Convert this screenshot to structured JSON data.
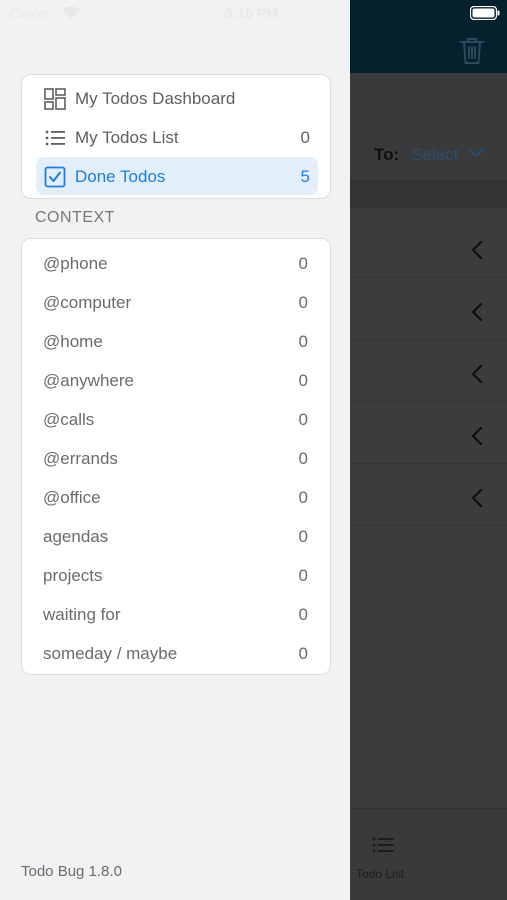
{
  "status_bar": {
    "carrier": "Carrier",
    "time": "3:15 PM"
  },
  "background": {
    "to_label": "To:",
    "select_label": "Select",
    "row_count": 5,
    "tab_label": "Todo List"
  },
  "drawer": {
    "nav": [
      {
        "label": "My Todos Dashboard",
        "count": "",
        "icon": "dashboard-icon",
        "selected": false
      },
      {
        "label": "My Todos List",
        "count": "0",
        "icon": "list-icon",
        "selected": false
      },
      {
        "label": "Done Todos",
        "count": "5",
        "icon": "checkbox-icon",
        "selected": true
      }
    ],
    "context_header": "CONTEXT",
    "contexts": [
      {
        "label": "@phone",
        "count": "0"
      },
      {
        "label": "@computer",
        "count": "0"
      },
      {
        "label": "@home",
        "count": "0"
      },
      {
        "label": "@anywhere",
        "count": "0"
      },
      {
        "label": "@calls",
        "count": "0"
      },
      {
        "label": "@errands",
        "count": "0"
      },
      {
        "label": "@office",
        "count": "0"
      },
      {
        "label": "agendas",
        "count": "0"
      },
      {
        "label": "projects",
        "count": "0"
      },
      {
        "label": "waiting for",
        "count": "0"
      },
      {
        "label": "someday / maybe",
        "count": "0"
      }
    ],
    "version": "Todo Bug 1.8.0"
  },
  "colors": {
    "accent": "#1d7fd6",
    "selected_bg": "#e2effb",
    "navbar": "#06202d"
  }
}
